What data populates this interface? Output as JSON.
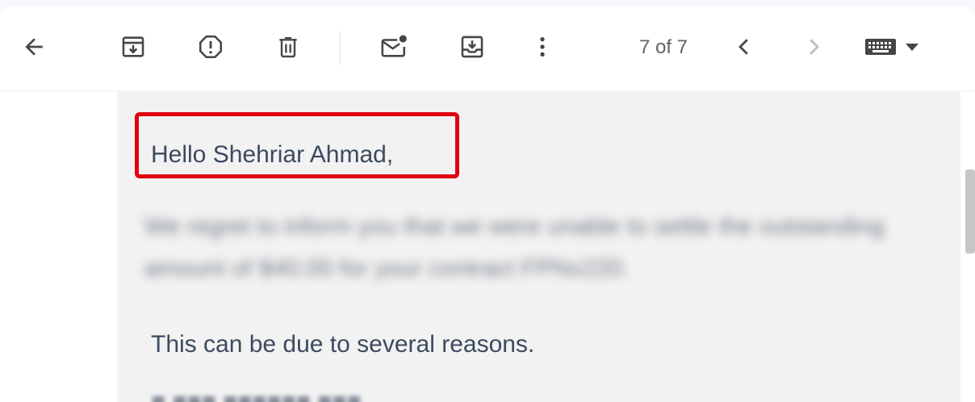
{
  "toolbar": {
    "back_icon": "arrow-left-icon",
    "archive_icon": "archive-icon",
    "report_spam_icon": "report-spam-icon",
    "delete_icon": "trash-icon",
    "mark_unread_icon": "mark-unread-icon",
    "move_to_icon": "move-to-inbox-icon",
    "more_icon": "more-vert-icon",
    "counter": "7 of 7",
    "prev_icon": "chevron-left-icon",
    "next_icon": "chevron-right-icon",
    "input_tools_icon": "keyboard-icon",
    "input_tools_dropdown_icon": "caret-down-icon"
  },
  "email": {
    "greeting": "Hello Shehriar Ahmad,",
    "blurred_lines": [
      "We regret to inform you that we were unable to settle the outstanding",
      "amount of $40.00 for your contract FPNx220."
    ],
    "reason_line": "This can be due to several reasons.",
    "partial_line": "■ ■■■ ■■■■■■ ■■■"
  },
  "colors": {
    "highlight": "#e0000f",
    "text": "#3c4a5f",
    "icon": "#444746"
  }
}
